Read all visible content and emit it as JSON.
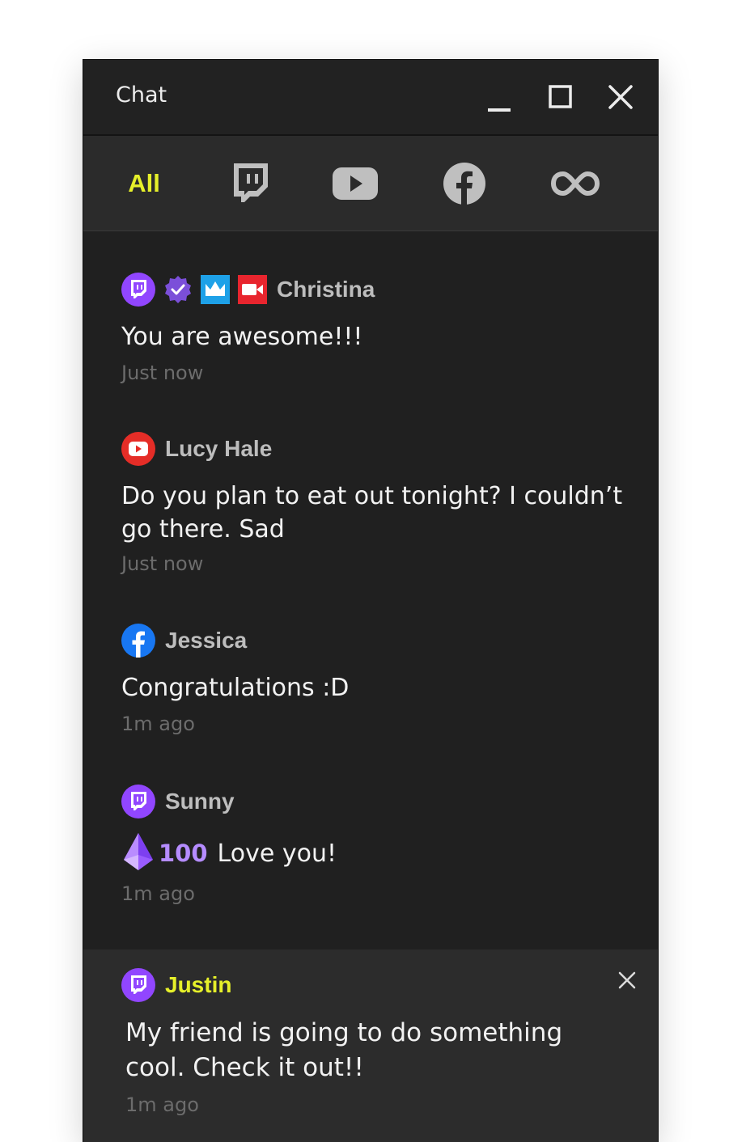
{
  "window": {
    "title": "Chat"
  },
  "tabs": {
    "all_label": "All",
    "icons": [
      "twitch-icon",
      "youtube-icon",
      "facebook-icon",
      "infinity-icon"
    ],
    "active_color": "#e6f02a"
  },
  "messages": [
    {
      "platform": "twitch",
      "badges": [
        "verified-badge-icon",
        "crown-badge-icon",
        "camera-badge-icon"
      ],
      "username": "Christina",
      "text": "You are awesome!!!",
      "time": "Just now"
    },
    {
      "platform": "youtube",
      "username": "Lucy Hale",
      "text": "Do you plan to eat out tonight? I couldn’t go there. Sad",
      "time": "Just now"
    },
    {
      "platform": "facebook",
      "username": "Jessica",
      "text": "Congratulations :D",
      "time": "1m ago"
    },
    {
      "platform": "twitch",
      "username": "Sunny",
      "bits": "100",
      "text": "Love you!",
      "time": "1m ago"
    }
  ],
  "notice": {
    "platform": "twitch",
    "username": "Justin",
    "text": "My friend is going to do something cool. Check it out!!",
    "time": "1m ago"
  },
  "colors": {
    "twitch": "#9146ff",
    "youtube": "#e52d27",
    "facebook": "#1877f2",
    "bits": "#b58cff",
    "highlight_name": "#e6f02a"
  }
}
